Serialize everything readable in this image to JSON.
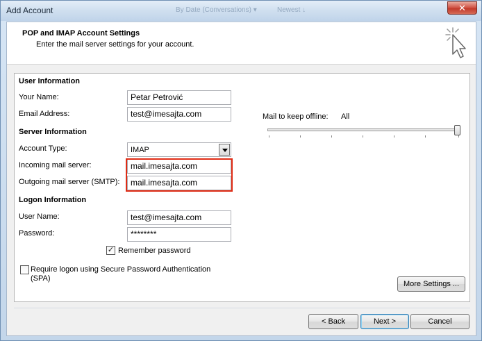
{
  "window": {
    "title": "Add Account",
    "ghost_left": "By Date (Conversations) ▾",
    "ghost_right": "Newest ↓",
    "close_symbol": "✕"
  },
  "header": {
    "title": "POP and IMAP Account Settings",
    "subtitle": "Enter the mail server settings for your account.",
    "icon": "cursor-sparkle-icon"
  },
  "user_info": {
    "section": "User Information",
    "name_label": "Your Name:",
    "name_value": "Petar Petrović",
    "email_label": "Email Address:",
    "email_value": "test@imesajta.com"
  },
  "server_info": {
    "section": "Server Information",
    "account_type_label": "Account Type:",
    "account_type_value": "IMAP",
    "incoming_label": "Incoming mail server:",
    "incoming_value": "mail.imesajta.com",
    "outgoing_label": "Outgoing mail server (SMTP):",
    "outgoing_value": "mail.imesajta.com"
  },
  "logon_info": {
    "section": "Logon Information",
    "username_label": "User Name:",
    "username_value": "test@imesajta.com",
    "password_label": "Password:",
    "password_value": "********",
    "remember_label": "Remember password",
    "remember_checked": true,
    "spa_label_line1": "Require logon using Secure Password Authentication",
    "spa_label_line2": "(SPA)",
    "spa_checked": false
  },
  "offline": {
    "label": "Mail to keep offline:",
    "value": "All",
    "slider_fraction": 1.0
  },
  "buttons": {
    "more_settings": "More Settings ...",
    "back": "< Back",
    "next": "Next >",
    "cancel": "Cancel"
  },
  "colors": {
    "highlight_border": "#e02b14",
    "close_button": "#c23b2c"
  }
}
